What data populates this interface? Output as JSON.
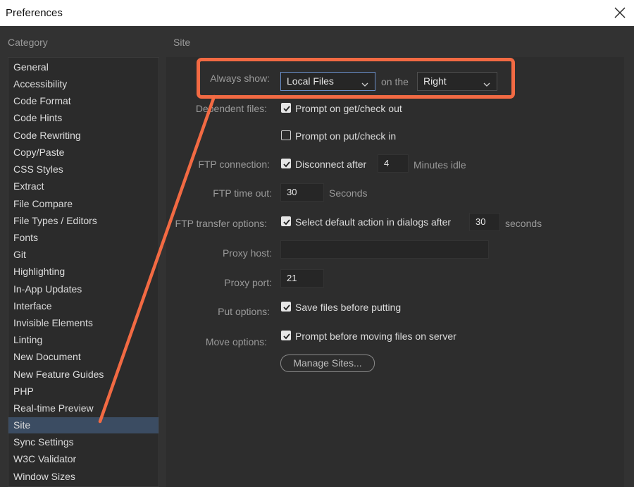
{
  "window": {
    "title": "Preferences"
  },
  "category_label": "Category",
  "section_label": "Site",
  "sidebar": {
    "items": [
      "General",
      "Accessibility",
      "Code Format",
      "Code Hints",
      "Code Rewriting",
      "Copy/Paste",
      "CSS Styles",
      "Extract",
      "File Compare",
      "File Types / Editors",
      "Fonts",
      "Git",
      "Highlighting",
      "In-App Updates",
      "Interface",
      "Invisible Elements",
      "Linting",
      "New Document",
      "New Feature Guides",
      "PHP",
      "Real-time Preview",
      "Site",
      "Sync Settings",
      "W3C Validator",
      "Window Sizes"
    ],
    "selected": "Site"
  },
  "site": {
    "always_show": {
      "label": "Always show:",
      "value": "Local Files",
      "on_the": "on the",
      "side": "Right"
    },
    "dependent_files": {
      "label": "Dependent files:",
      "opt1": "Prompt on get/check out",
      "opt1_checked": true,
      "opt2": "Prompt on put/check in",
      "opt2_checked": false
    },
    "ftp_connection": {
      "label": "FTP connection:",
      "text": "Disconnect after",
      "checked": true,
      "value": "4",
      "suffix": "Minutes idle"
    },
    "ftp_timeout": {
      "label": "FTP time out:",
      "value": "30",
      "suffix": "Seconds"
    },
    "ftp_transfer": {
      "label": "FTP transfer options:",
      "text": "Select default action in dialogs after",
      "checked": true,
      "value": "30",
      "suffix": "seconds"
    },
    "proxy_host": {
      "label": "Proxy host:",
      "value": ""
    },
    "proxy_port": {
      "label": "Proxy port:",
      "value": "21"
    },
    "put_options": {
      "label": "Put options:",
      "text": "Save files before putting",
      "checked": true
    },
    "move_options": {
      "label": "Move options:",
      "text": "Prompt before moving files on server",
      "checked": true
    },
    "manage_sites": "Manage Sites..."
  },
  "colors": {
    "accent": "#f26a43",
    "selected_row": "#3b4c62",
    "background": "#323232"
  }
}
